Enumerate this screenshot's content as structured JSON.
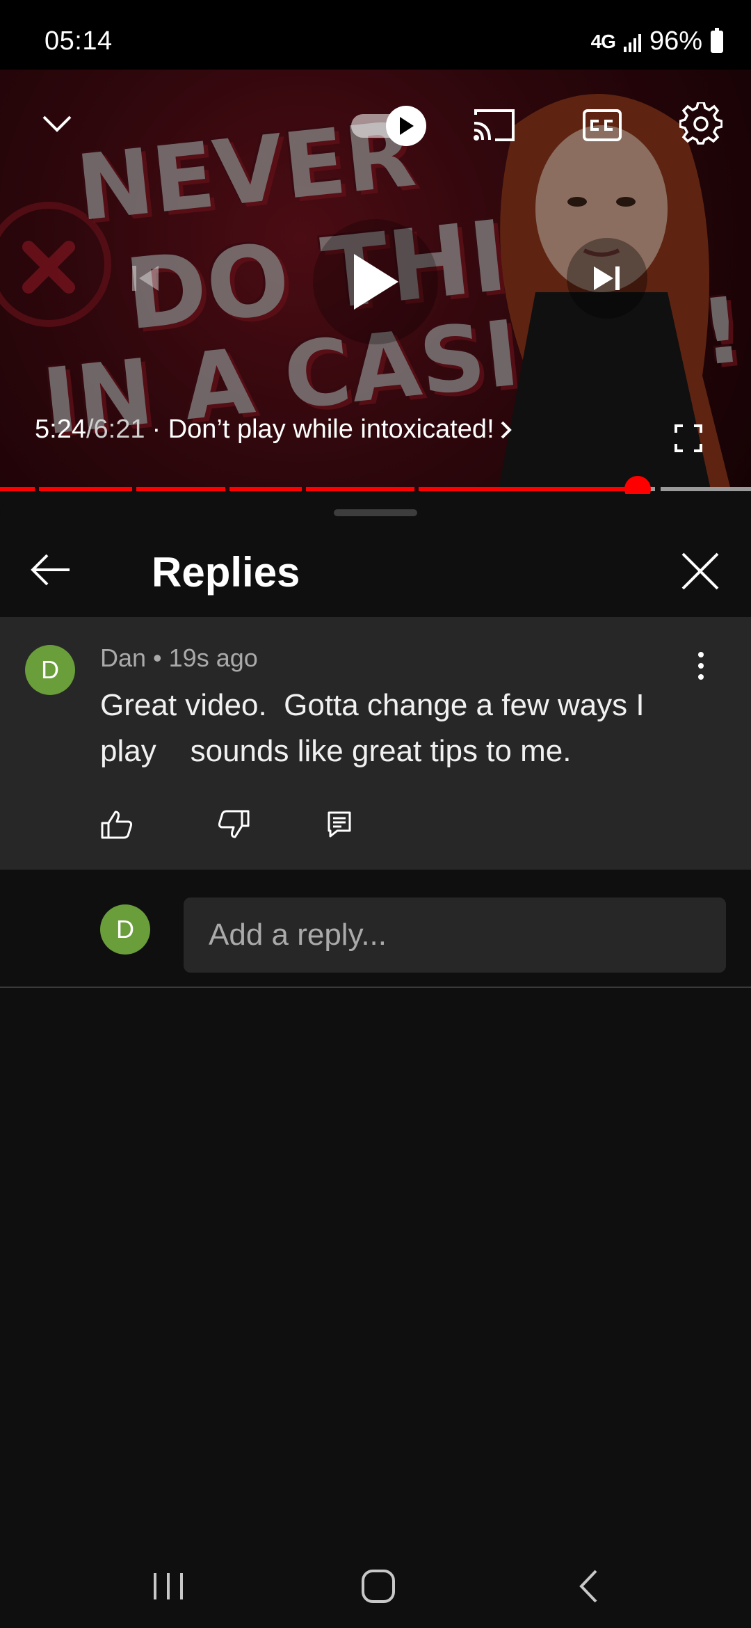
{
  "status_bar": {
    "time": "05:14",
    "network": "4G",
    "battery": "96%"
  },
  "player": {
    "thumbnail_text": {
      "line1": "NEVER",
      "line2": "DO THIS",
      "line3": "IN A CASINO !"
    },
    "time_current": "5:24",
    "time_separator": " / ",
    "time_total": "6:21",
    "chapter_title": "· Don’t play while intoxicated!",
    "progress_fraction": 0.85,
    "accent_color": "#ff0000",
    "icons": [
      "chevron-down-icon",
      "autoplay-toggle",
      "cast-icon",
      "closed-captions-icon",
      "gear-icon",
      "previous-icon",
      "play-icon",
      "next-icon",
      "fullscreen-icon"
    ]
  },
  "sheet": {
    "title": "Replies"
  },
  "comment": {
    "avatar_letter": "D",
    "author": "Dan",
    "age": "19s ago",
    "meta_separator": " • ",
    "text": "Great video.  Gotta change a few ways I play    sounds like great tips to me."
  },
  "reply_box": {
    "avatar_letter": "D",
    "placeholder": "Add a reply..."
  },
  "colors": {
    "avatar": "#6a9e3a",
    "comment_bg": "#272727",
    "background": "#0f0f0f"
  }
}
